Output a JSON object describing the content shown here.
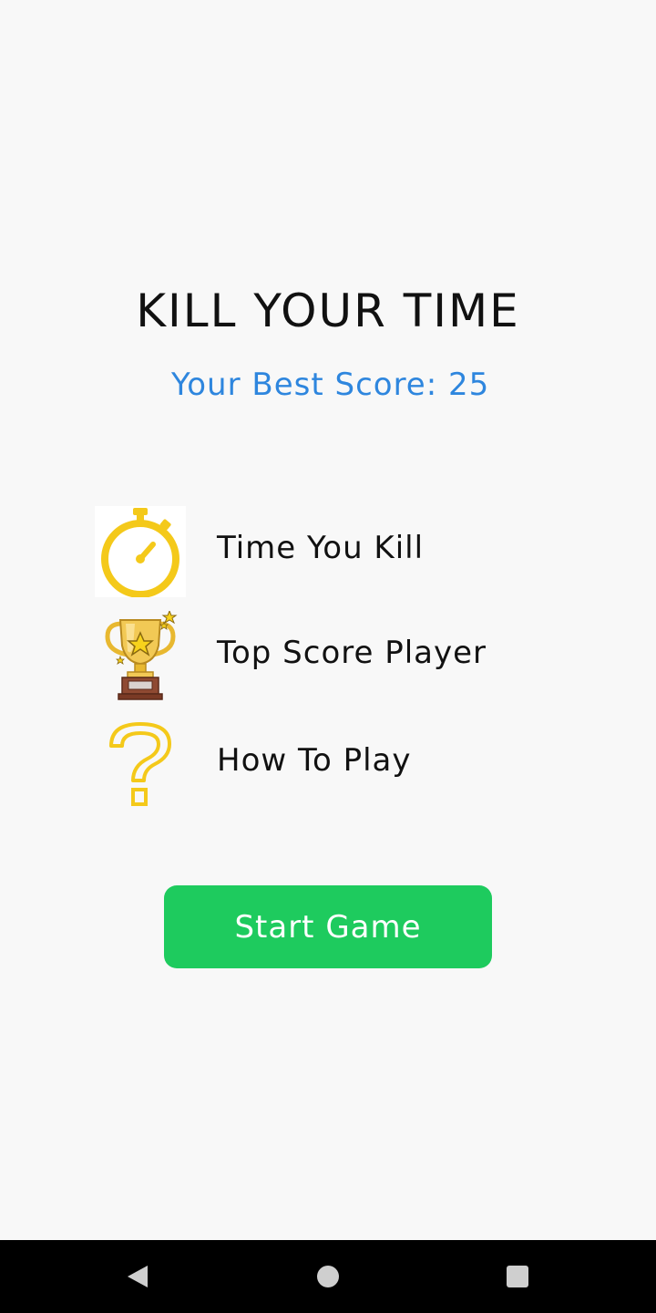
{
  "app": {
    "title": "KILL YOUR TIME",
    "best_score_text": "Your Best Score: 25"
  },
  "menu": {
    "items": [
      {
        "label": "Time You Kill",
        "icon": "stopwatch-icon"
      },
      {
        "label": "Top Score Player",
        "icon": "trophy-icon"
      },
      {
        "label": "How To Play",
        "icon": "question-mark-icon"
      }
    ]
  },
  "start_button": {
    "label": "Start Game",
    "color": "#1ecb5e"
  },
  "colors": {
    "background": "#f8f8f8",
    "best_score": "#2e86de",
    "icon_yellow": "#f4c91a"
  },
  "navbar": {
    "buttons": [
      "back-icon",
      "home-icon",
      "recent-apps-icon"
    ]
  }
}
